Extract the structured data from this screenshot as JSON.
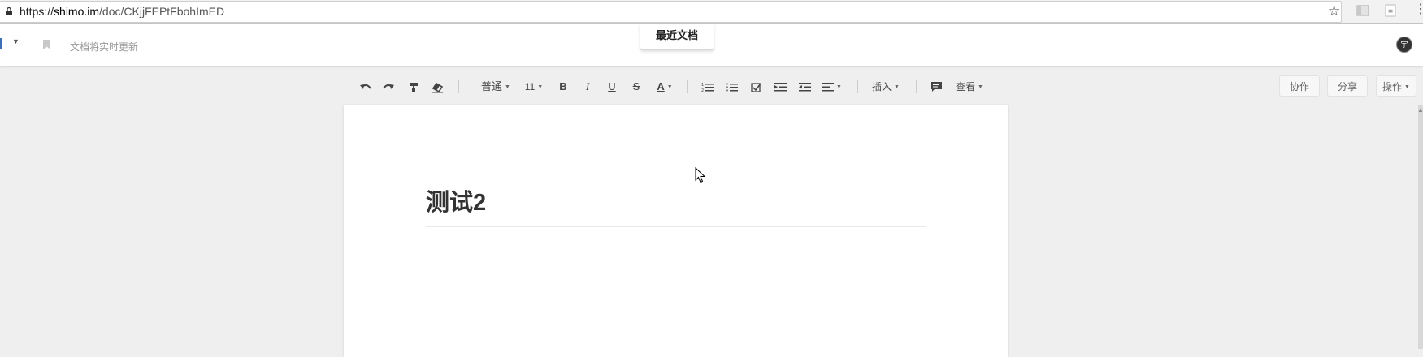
{
  "browser": {
    "url_scheme": "https://",
    "url_domain": "shimo.im",
    "url_path": "/doc/CKjjFEPtFbohImED",
    "icons": [
      "lock-icon",
      "star-icon",
      "extension-icon",
      "menu-icon"
    ]
  },
  "header": {
    "status_text": "文档将实时更新",
    "recent_docs_label": "最近文档",
    "avatar_text": "宇"
  },
  "toolbar": {
    "style_label": "普通",
    "font_size_label": "11",
    "bold_label": "B",
    "italic_label": "I",
    "underline_label": "U",
    "strike_label": "S",
    "font_color_label": "A",
    "insert_label": "插入",
    "view_label": "查看"
  },
  "actions": {
    "collaborate_label": "协作",
    "share_label": "分享",
    "operations_label": "操作"
  },
  "document": {
    "title": "测试2"
  },
  "colors": {
    "accent": "#3b6fb6",
    "page_bg": "#efefef"
  }
}
